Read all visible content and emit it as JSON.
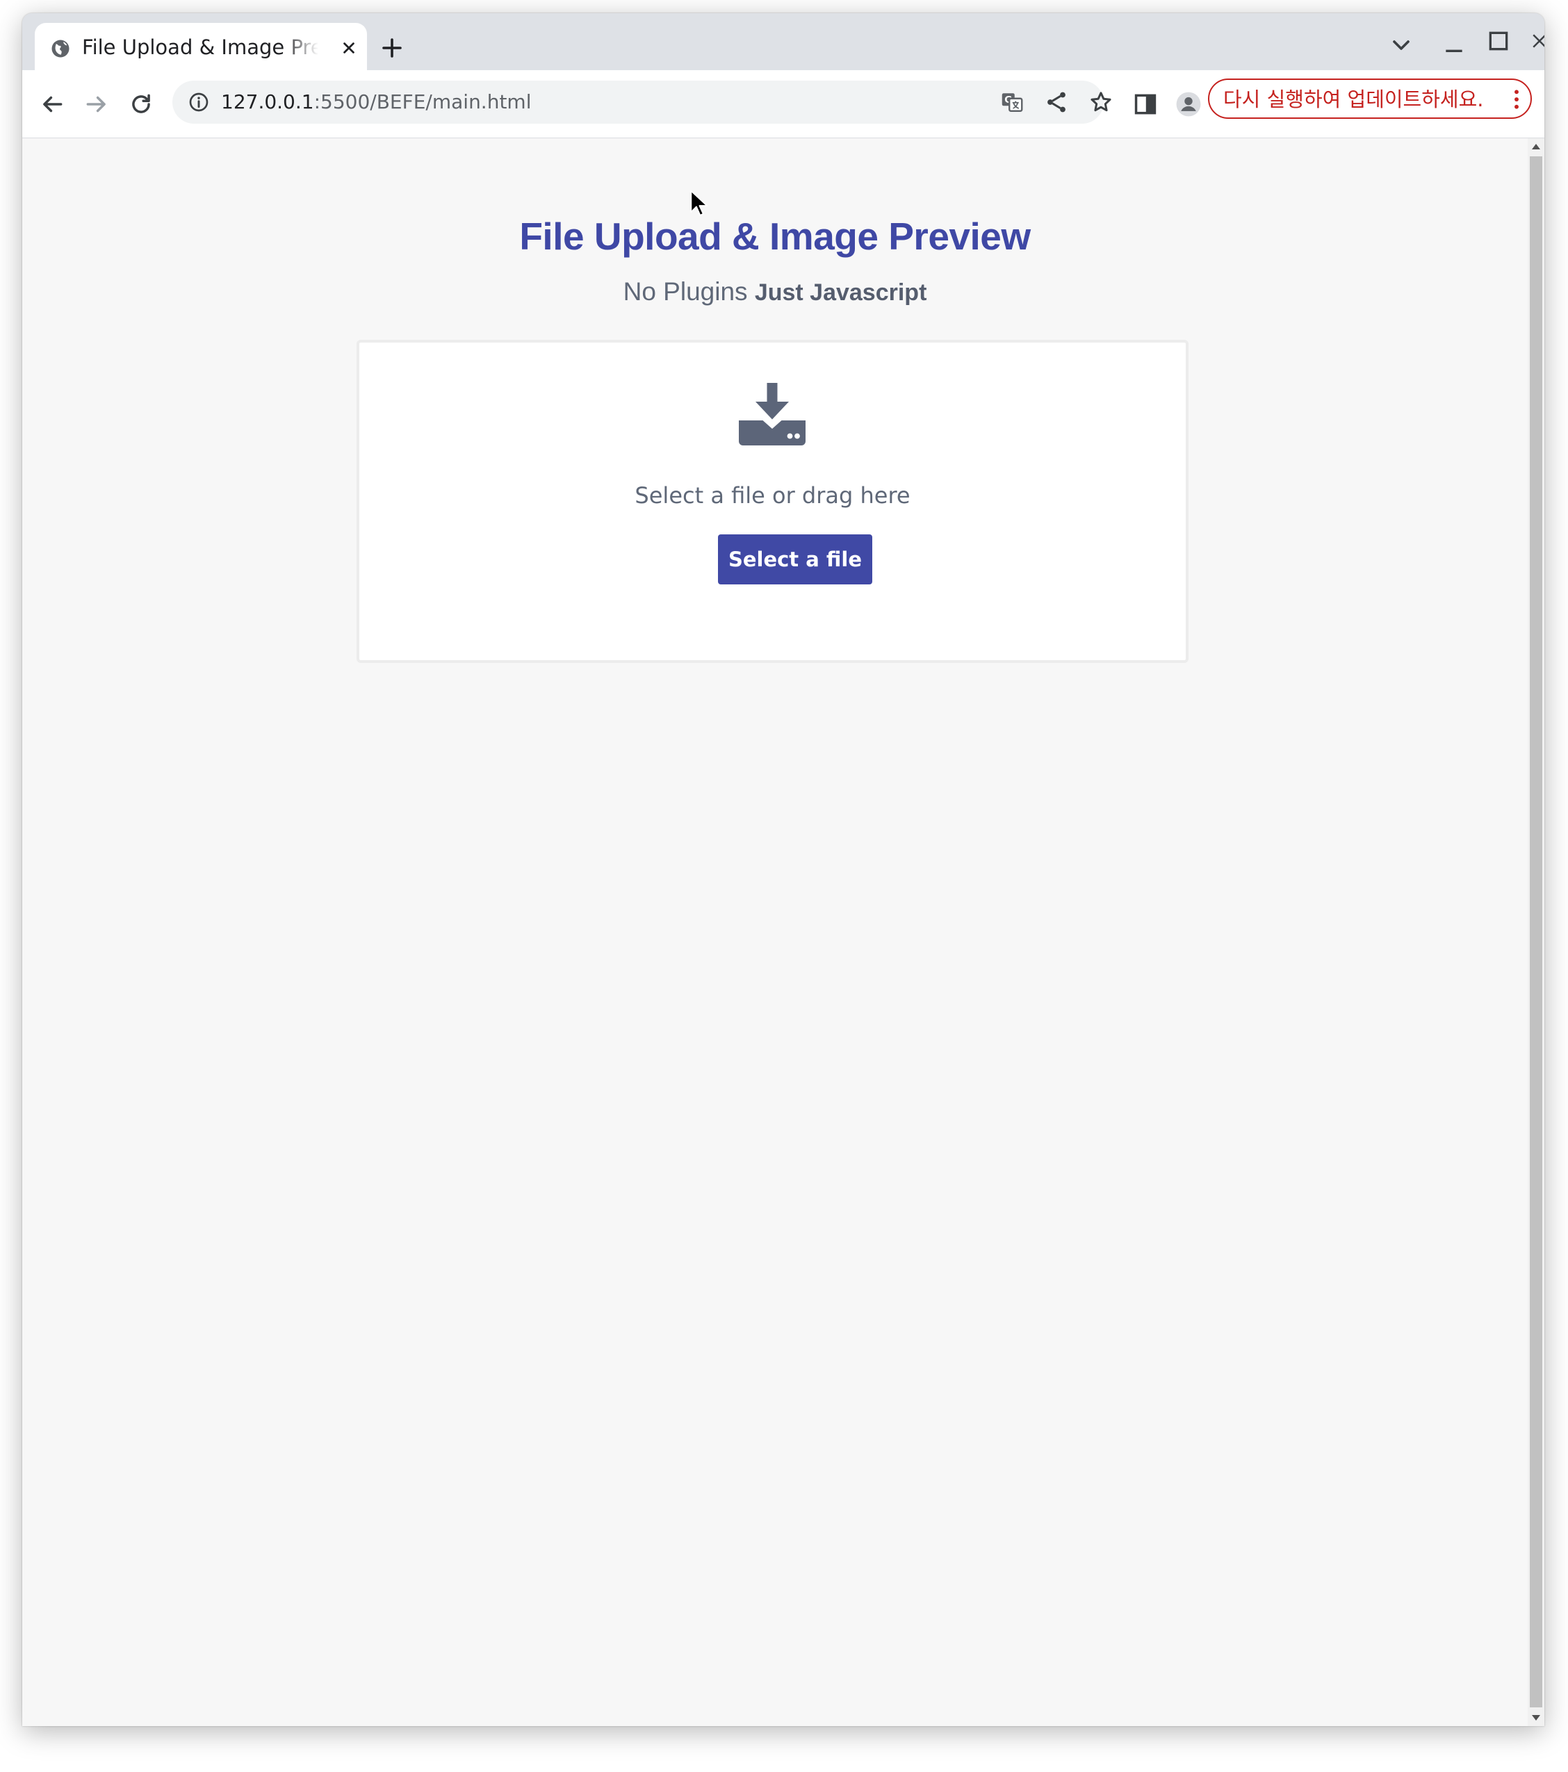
{
  "browser": {
    "tab": {
      "title": "File Upload & Image Preview",
      "favicon": "globe-icon",
      "close_icon": "close-icon"
    },
    "new_tab_icon": "plus-icon",
    "window_controls": [
      "chevron-down-icon",
      "minimize-icon",
      "maximize-icon",
      "close-icon"
    ],
    "toolbar": {
      "back_icon": "back-arrow-icon",
      "forward_icon": "forward-arrow-icon",
      "reload_icon": "reload-icon",
      "url_host": "127.0.0.1",
      "url_path": ":5500/BEFE/main.html",
      "site_info_icon": "info-icon",
      "omnibox_actions": [
        "translate-icon",
        "share-icon",
        "star-icon"
      ],
      "side_panel_icon": "side-panel-icon",
      "profile_icon": "profile-icon",
      "update_label": "다시 실행하여 업데이트하세요.",
      "menu_icon": "kebab-menu-icon"
    }
  },
  "page": {
    "title": "File Upload & Image Preview",
    "subtitle_plain": "No Plugins",
    "subtitle_bold": "Just Javascript",
    "upload": {
      "icon": "download-tray-icon",
      "prompt": "Select a file or drag here",
      "button_label": "Select a file"
    }
  },
  "colors": {
    "accent": "#3f48a5",
    "button": "#4049a5",
    "update_red": "#c5221f",
    "page_bg": "#f7f7f7",
    "muted_text": "#5f6878"
  }
}
